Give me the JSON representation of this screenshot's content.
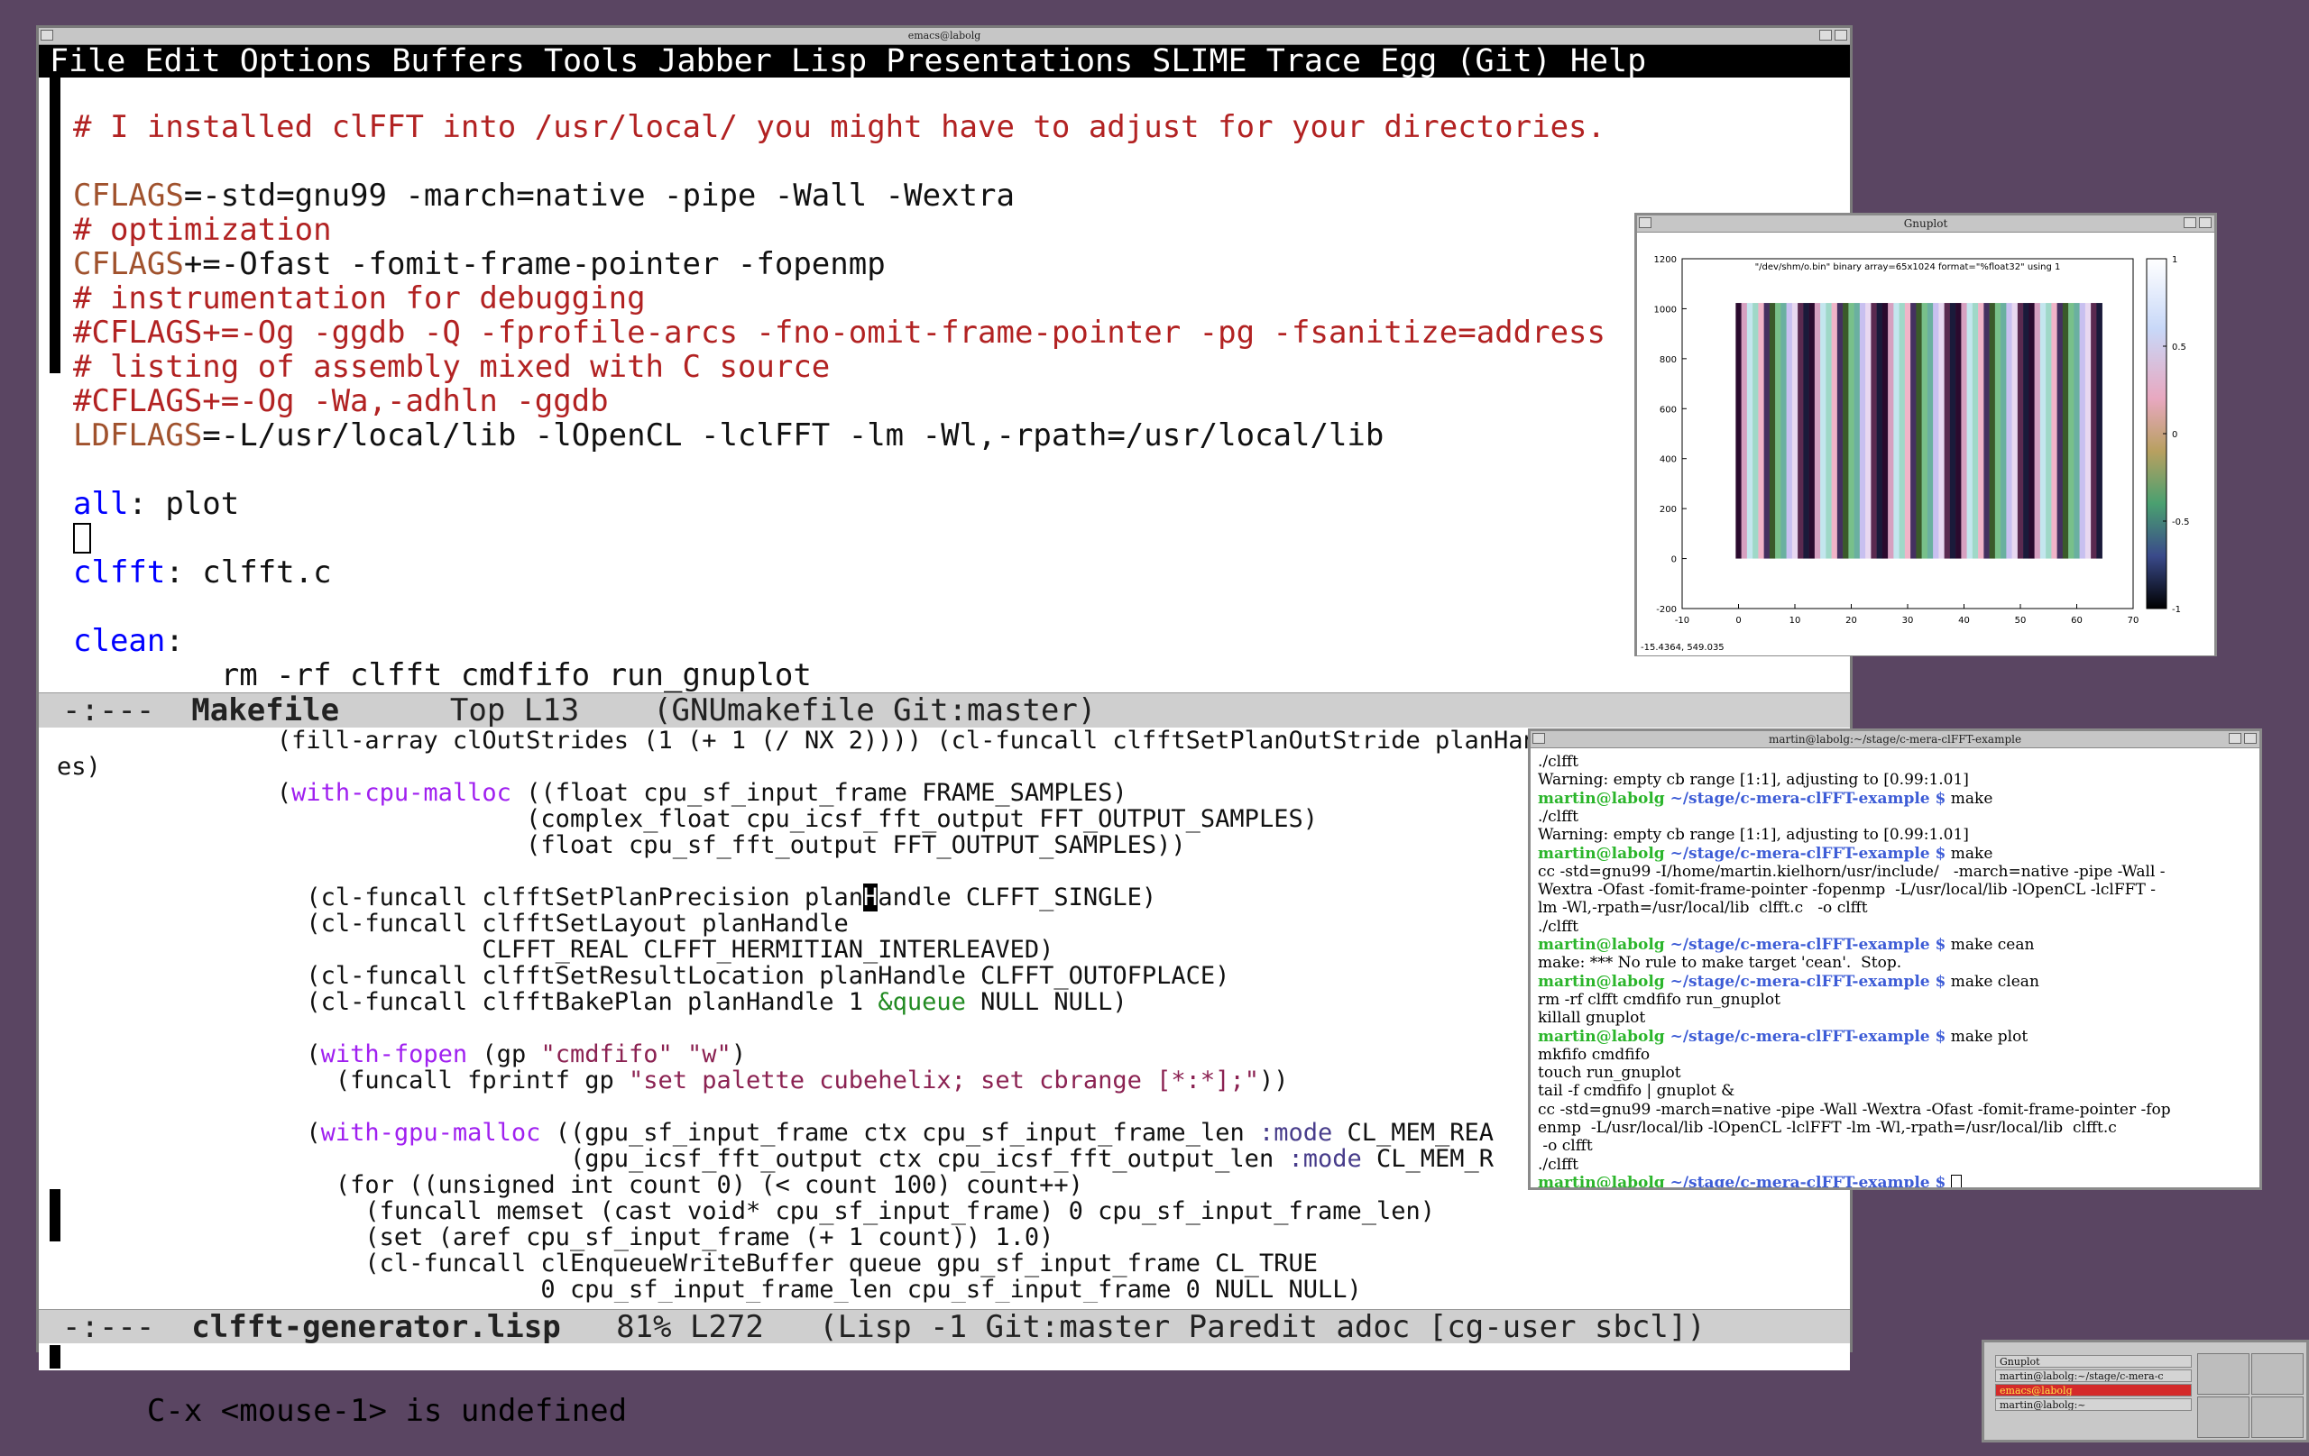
{
  "emacs": {
    "title": "emacs@labolg",
    "menu": [
      "File",
      "Edit",
      "Options",
      "Buffers",
      "Tools",
      "Jabber",
      "Lisp",
      "Presentations",
      "SLIME",
      "Trace",
      "Egg (Git)",
      "Help"
    ],
    "makefile": {
      "l1": "# I installed clFFT into /usr/local/ you might have to adjust for your directories.",
      "l3a": "CFLAGS",
      "l3b": "=-std=gnu99 -march=native -pipe -Wall -Wextra",
      "l4": "# optimization",
      "l5a": "CFLAGS",
      "l5b": "+=-Ofast -fomit-frame-pointer -fopenmp",
      "l6": "# instrumentation for debugging",
      "l7": "#CFLAGS+=-Og -ggdb -Q -fprofile-arcs -fno-omit-frame-pointer -pg -fsanitize=address",
      "l8": "# listing of assembly mixed with C source",
      "l9": "#CFLAGS+=-Og -Wa,-adhln -ggdb",
      "l10a": "LDFLAGS",
      "l10b": "=-L/usr/local/lib -lOpenCL -lclFFT -lm -Wl,-rpath=/usr/local/lib",
      "l12a": "all",
      "l12b": ": plot",
      "l14a": "clfft",
      "l14b": ": clfft.c",
      "l16a": "clean",
      "l16b": ":",
      "l17": "        rm -rf clfft cmdfifo run_gnuplot"
    },
    "modeline1": {
      "state": "-:---  ",
      "buffer": "Makefile",
      "position": "      Top L13    ",
      "modes": "(GNUmakefile Git:master)"
    },
    "lisp": {
      "a1": "               (fill-array clOutStrides (1 (+ 1 (/ NX 2)))) (cl-funcall clfftSetPlanOutStride planHandle dim clOutStrid",
      "a2": "es)",
      "a3a": "               (",
      "a3b": "with-cpu-malloc",
      "a3c": " ((float cpu_sf_input_frame FRAME_SAMPLES)",
      "a4": "                                (complex_float cpu_icsf_fft_output FFT_OUTPUT_SAMPLES)",
      "a5": "                                (float cpu_sf_fft_output FFT_OUTPUT_SAMPLES))",
      "a7a": "                 (cl-funcall clfftSetPlanPrecision plan",
      "a7b": "H",
      "a7c": "andle CLFFT_SINGLE)",
      "a8": "                 (cl-funcall clfftSetLayout planHandle",
      "a9": "                             CLFFT_REAL CLFFT_HERMITIAN_INTERLEAVED)",
      "a10": "                 (cl-funcall clfftSetResultLocation planHandle CLFFT_OUTOFPLACE)",
      "a11a": "                 (cl-funcall clfftBakePlan planHandle 1 ",
      "a11b": "&queue",
      "a11c": " NULL NULL)",
      "a13a": "                 (",
      "a13b": "with-fopen",
      "a13c": " (gp ",
      "a13d": "\"cmdfifo\"",
      "a13e": " ",
      "a13f": "\"w\"",
      "a13g": ")",
      "a14a": "                   (funcall fprintf gp ",
      "a14b": "\"set palette cubehelix; set cbrange [*:*];\"",
      "a14c": "))",
      "a16a": "                 (",
      "a16b": "with-gpu-malloc",
      "a16c": " ((gpu_sf_input_frame ctx cpu_sf_input_frame_len ",
      "a16d": ":mode",
      "a16e": " CL_MEM_REA",
      "a17a": "                                   (gpu_icsf_fft_output ctx cpu_icsf_fft_output_len ",
      "a17b": ":mode",
      "a17c": " CL_MEM_R",
      "a18": "                   (for ((unsigned int count 0) (< count 100) count++)",
      "a19": "                     (funcall memset (cast void* cpu_sf_input_frame) 0 cpu_sf_input_frame_len)",
      "a20": "                     (set (aref cpu_sf_input_frame (+ 1 count)) 1.0)",
      "a21": "                     (cl-funcall clEnqueueWriteBuffer queue gpu_sf_input_frame CL_TRUE",
      "a22": "                                 0 cpu_sf_input_frame_len cpu_sf_input_frame 0 NULL NULL)"
    },
    "modeline2": {
      "state": "-:---  ",
      "buffer": "clfft-generator.lisp",
      "position": "   81% L272   ",
      "modes": "(Lisp -1 Git:master Paredit adoc [cg-user sbcl])"
    },
    "minibuffer": "C-x <mouse-1> is undefined"
  },
  "gnuplot": {
    "title": "Gnuplot",
    "plot_title": "\"/dev/shm/o.bin\" binary array=65x1024 format=\"%float32\" using 1",
    "coords": "-15.4364,  549.035"
  },
  "chart_data": {
    "type": "heatmap",
    "title": "\"/dev/shm/o.bin\" binary array=65x1024 format=\"%float32\" using 1",
    "xlim": [
      -10,
      70
    ],
    "ylim": [
      -200,
      1200
    ],
    "xticks": [
      "-10",
      "0",
      "10",
      "20",
      "30",
      "40",
      "50",
      "60",
      "70"
    ],
    "yticks": [
      "-200",
      "0",
      "200",
      "400",
      "600",
      "800",
      "1000",
      "1200"
    ],
    "colorbar_ticks": [
      "1",
      "0.5",
      "0",
      "-0.5",
      "-1"
    ],
    "cbrange": [
      -1,
      1
    ],
    "palette": "cubehelix",
    "data_x_range": [
      0,
      64
    ],
    "data_y_range": [
      0,
      1023
    ]
  },
  "xterm": {
    "title": "martin@labolg:~/stage/c-mera-clFFT-example",
    "lines": [
      {
        "t": "./clfft"
      },
      {
        "t": "Warning: empty cb range [1:1], adjusting to [0.99:1.01]"
      },
      {
        "u": "martin@labolg",
        "p": " ~/stage/c-mera-clFFT-example $",
        "c": " make"
      },
      {
        "t": "./clfft"
      },
      {
        "t": "Warning: empty cb range [1:1], adjusting to [0.99:1.01]"
      },
      {
        "u": "martin@labolg",
        "p": " ~/stage/c-mera-clFFT-example $",
        "c": " make"
      },
      {
        "t": "cc -std=gnu99 -I/home/martin.kielhorn/usr/include/   -march=native -pipe -Wall -"
      },
      {
        "t": "Wextra -Ofast -fomit-frame-pointer -fopenmp  -L/usr/local/lib -lOpenCL -lclFFT -"
      },
      {
        "t": "lm -Wl,-rpath=/usr/local/lib  clfft.c   -o clfft"
      },
      {
        "t": "./clfft"
      },
      {
        "u": "martin@labolg",
        "p": " ~/stage/c-mera-clFFT-example $",
        "c": " make cean"
      },
      {
        "t": "make: *** No rule to make target 'cean'.  Stop."
      },
      {
        "u": "martin@labolg",
        "p": " ~/stage/c-mera-clFFT-example $",
        "c": " make clean"
      },
      {
        "t": "rm -rf clfft cmdfifo run_gnuplot"
      },
      {
        "t": "killall gnuplot"
      },
      {
        "u": "martin@labolg",
        "p": " ~/stage/c-mera-clFFT-example $",
        "c": " make plot"
      },
      {
        "t": "mkfifo cmdfifo"
      },
      {
        "t": "touch run_gnuplot"
      },
      {
        "t": "tail -f cmdfifo | gnuplot &"
      },
      {
        "t": "cc -std=gnu99 -march=native -pipe -Wall -Wextra -Ofast -fomit-frame-pointer -fop"
      },
      {
        "t": "enmp  -L/usr/local/lib -lOpenCL -lclFFT -lm -Wl,-rpath=/usr/local/lib  clfft.c"
      },
      {
        "t": " -o clfft"
      },
      {
        "t": "./clfft"
      },
      {
        "u": "martin@labolg",
        "p": " ~/stage/c-mera-clFFT-example $",
        "c": " "
      }
    ]
  },
  "pager": {
    "items": [
      "Gnuplot",
      "martin@labolg:~/stage/c-mera-c",
      "emacs@labolg",
      "martin@labolg:~"
    ]
  }
}
